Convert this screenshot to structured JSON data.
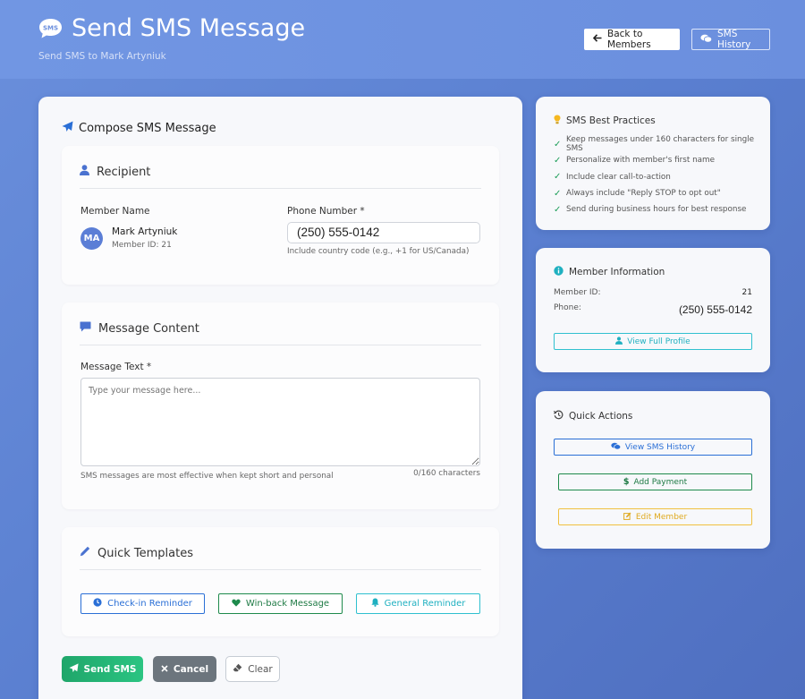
{
  "header": {
    "title": "Send SMS Message",
    "subtitle": "Send SMS to Mark Artyniuk",
    "sms_icon_text": "SMS",
    "back_label": "Back to Members",
    "history_label": "SMS History"
  },
  "compose": {
    "heading": "Compose SMS Message",
    "recipient": {
      "heading": "Recipient",
      "member_name_label": "Member Name",
      "avatar_initials": "MA",
      "member_name": "Mark Artyniuk",
      "member_id": "Member ID: 21",
      "phone_label": "Phone Number *",
      "phone_value": "(250) 555-0142",
      "phone_hint": "Include country code (e.g., +1 for US/Canada)"
    },
    "message": {
      "heading": "Message Content",
      "text_label": "Message Text *",
      "placeholder": "Type your message here...",
      "hint": "SMS messages are most effective when kept short and personal",
      "char_count": "0/160 characters"
    },
    "templates": {
      "heading": "Quick Templates",
      "items": [
        {
          "label": "Check-in Reminder",
          "icon": "clock-icon"
        },
        {
          "label": "Win-back Message",
          "icon": "heart-icon"
        },
        {
          "label": "General Reminder",
          "icon": "bell-icon"
        }
      ]
    },
    "actions": {
      "send": "Send SMS",
      "cancel": "Cancel",
      "clear": "Clear"
    }
  },
  "best_practices": {
    "heading": "SMS Best Practices",
    "items": [
      "Keep messages under 160 characters for single SMS",
      "Personalize with member's first name",
      "Include clear call-to-action",
      "Always include \"Reply STOP to opt out\"",
      "Send during business hours for best response"
    ]
  },
  "member_info": {
    "heading": "Member Information",
    "id_label": "Member ID:",
    "id_value": "21",
    "phone_label": "Phone:",
    "phone_value": "(250) 555-0142",
    "profile_button": "View Full Profile"
  },
  "quick_actions": {
    "heading": "Quick Actions",
    "history_button": "View SMS History",
    "payment_button": "Add Payment",
    "edit_button": "Edit Member"
  },
  "colors": {
    "accent_blue": "#2a6fd6",
    "success_green": "#1fa66a",
    "info_cyan": "#2fc0cf",
    "warning_yellow": "#f0c040",
    "cancel_gray": "#6c757d"
  }
}
